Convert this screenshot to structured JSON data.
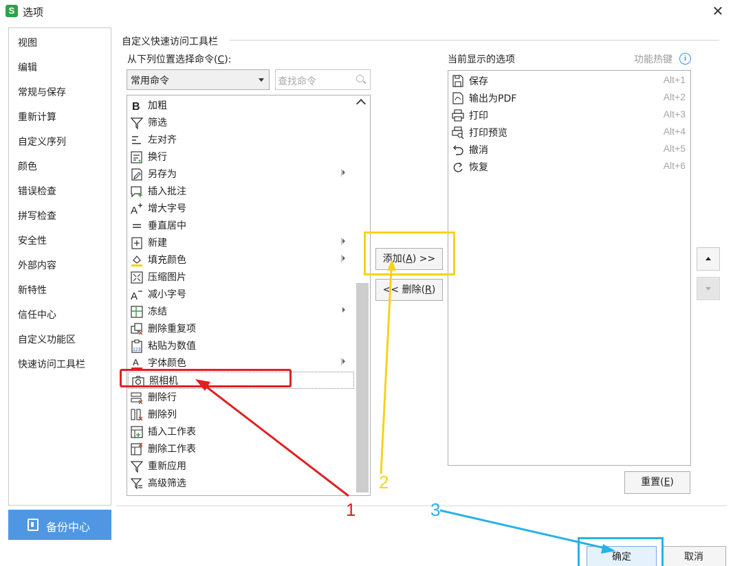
{
  "window": {
    "title": "选项",
    "app_icon_letter": "S",
    "close_glyph": "✕"
  },
  "sidebar": {
    "items": [
      {
        "label": "视图",
        "icon": ""
      },
      {
        "label": "编辑",
        "icon": ""
      },
      {
        "label": "常规与保存",
        "icon": ""
      },
      {
        "label": "重新计算",
        "icon": ""
      },
      {
        "label": "自定义序列",
        "icon": ""
      },
      {
        "label": "颜色",
        "icon": ""
      },
      {
        "label": "错误检查",
        "icon": ""
      },
      {
        "label": "拼写检查",
        "icon": ""
      },
      {
        "label": "安全性",
        "icon": ""
      },
      {
        "label": "外部内容",
        "icon": ""
      },
      {
        "label": "新特性",
        "icon": ""
      },
      {
        "label": "信任中心",
        "icon": ""
      },
      {
        "label": "自定义功能区",
        "icon": ""
      },
      {
        "label": "快速访问工具栏",
        "icon": ""
      }
    ],
    "backup_label": "备份中心"
  },
  "panel": {
    "section_title": "自定义快速访问工具栏",
    "from_label_pre": "从下列位置选择命令(",
    "from_label_key": "C",
    "from_label_post": "):",
    "dropdown_value": "常用命令",
    "search_placeholder": "查找命令",
    "commands": [
      {
        "label": "加粗",
        "icon": "bold-icon",
        "submenu": false
      },
      {
        "label": "筛选",
        "icon": "filter-icon",
        "submenu": false
      },
      {
        "label": "左对齐",
        "icon": "align-left-icon",
        "submenu": false
      },
      {
        "label": "换行",
        "icon": "wrap-text-icon",
        "submenu": false
      },
      {
        "label": "另存为",
        "icon": "save-as-icon",
        "submenu": true
      },
      {
        "label": "插入批注",
        "icon": "insert-comment-icon",
        "submenu": false
      },
      {
        "label": "增大字号",
        "icon": "increase-font-icon",
        "submenu": false
      },
      {
        "label": "垂直居中",
        "icon": "vertical-center-icon",
        "submenu": false
      },
      {
        "label": "新建",
        "icon": "new-icon",
        "submenu": true
      },
      {
        "label": "填充颜色",
        "icon": "fill-color-icon",
        "submenu": true
      },
      {
        "label": "压缩图片",
        "icon": "compress-image-icon",
        "submenu": false
      },
      {
        "label": "减小字号",
        "icon": "decrease-font-icon",
        "submenu": false
      },
      {
        "label": "冻结",
        "icon": "freeze-icon",
        "submenu": true
      },
      {
        "label": "删除重复项",
        "icon": "remove-duplicates-icon",
        "submenu": false
      },
      {
        "label": "粘贴为数值",
        "icon": "paste-values-icon",
        "submenu": false
      },
      {
        "label": "字体颜色",
        "icon": "font-color-icon",
        "submenu": true
      },
      {
        "label": "照相机",
        "icon": "camera-icon",
        "submenu": false,
        "selected": true
      },
      {
        "label": "删除行",
        "icon": "delete-row-icon",
        "submenu": false
      },
      {
        "label": "删除列",
        "icon": "delete-column-icon",
        "submenu": false
      },
      {
        "label": "插入工作表",
        "icon": "insert-sheet-icon",
        "submenu": false
      },
      {
        "label": "删除工作表",
        "icon": "delete-sheet-icon",
        "submenu": false
      },
      {
        "label": "重新应用",
        "icon": "reapply-icon",
        "submenu": false
      },
      {
        "label": "高级筛选",
        "icon": "advanced-filter-icon",
        "submenu": false
      }
    ],
    "add_pre": "添加(",
    "add_key": "A",
    "add_post": ") >>",
    "delete_pre": "<< 删除(",
    "delete_key": "R",
    "delete_post": ")",
    "current_label": "当前显示的选项",
    "hotkey_label": "功能热键",
    "info_glyph": "i",
    "current_items": [
      {
        "label": "保存",
        "hotkey": "Alt+1",
        "icon": "save-icon"
      },
      {
        "label": "输出为PDF",
        "hotkey": "Alt+2",
        "icon": "export-pdf-icon"
      },
      {
        "label": "打印",
        "hotkey": "Alt+3",
        "icon": "print-icon"
      },
      {
        "label": "打印预览",
        "hotkey": "Alt+4",
        "icon": "print-preview-icon"
      },
      {
        "label": "撤消",
        "hotkey": "Alt+5",
        "icon": "undo-icon"
      },
      {
        "label": "恢复",
        "hotkey": "Alt+6",
        "icon": "redo-icon"
      }
    ],
    "reset_pre": "重置(",
    "reset_key": "E",
    "reset_post": ")"
  },
  "footer": {
    "ok_label": "确定",
    "cancel_label": "取消"
  },
  "annotations": {
    "n1": "1",
    "n2": "2",
    "n3": "3",
    "colors": {
      "red": "#e02020",
      "yellow": "#f7d21a",
      "blue": "#27b2e8"
    }
  }
}
